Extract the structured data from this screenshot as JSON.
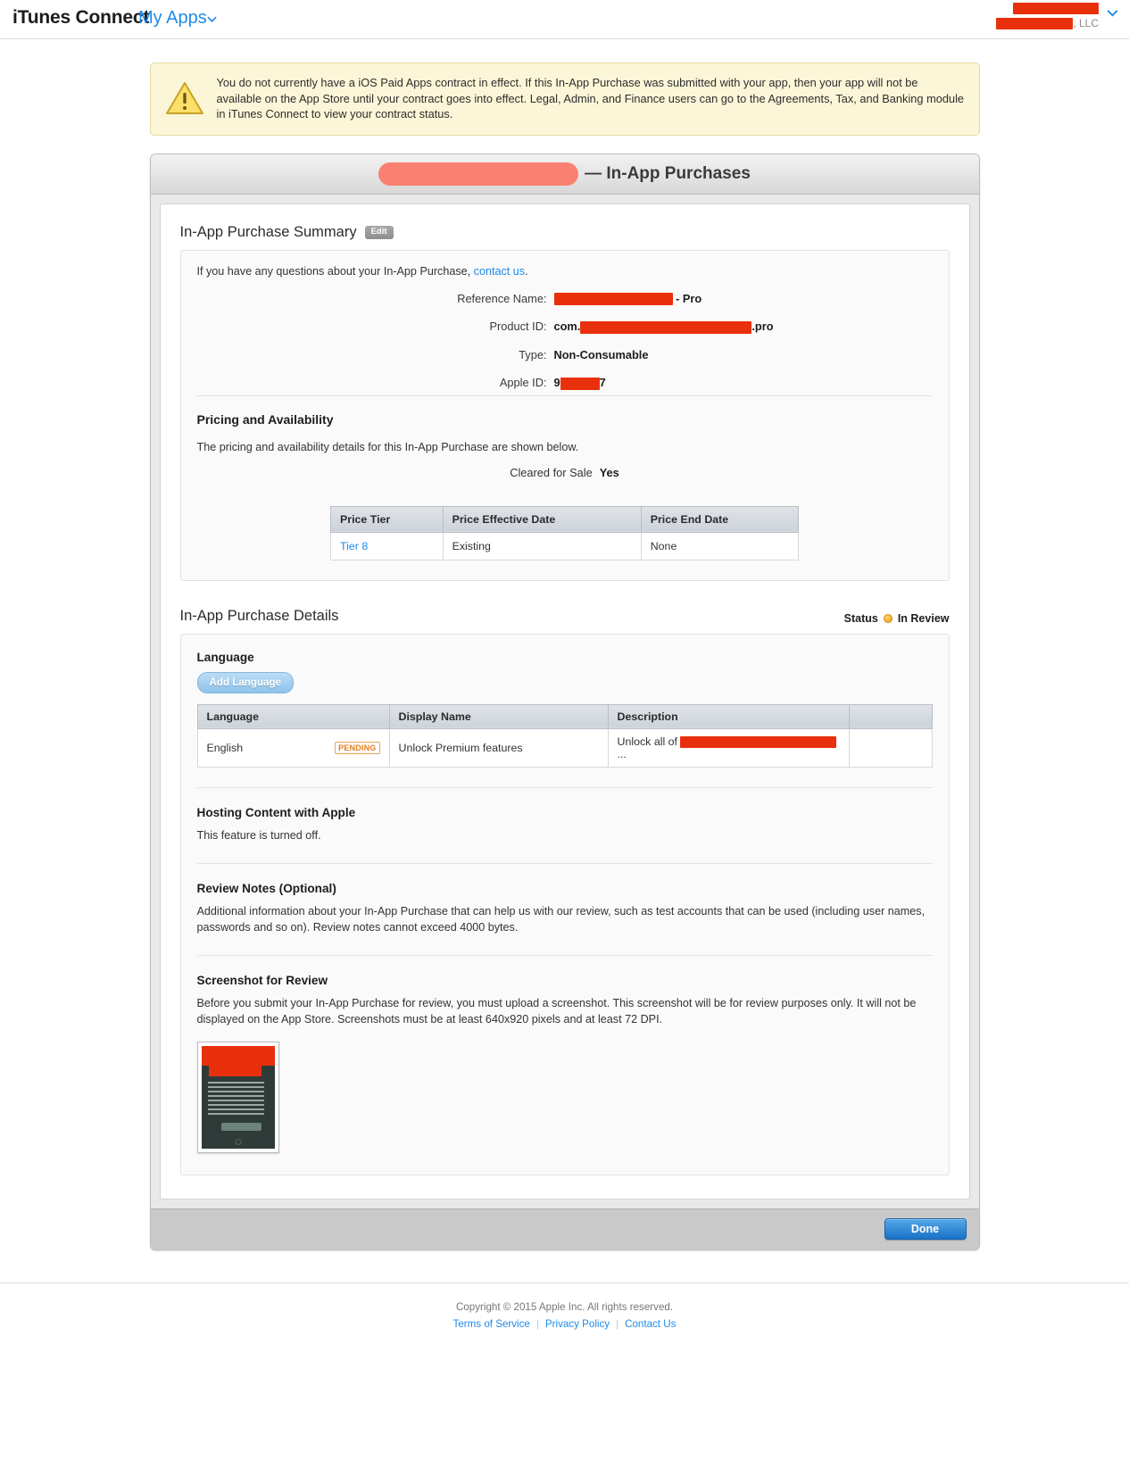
{
  "nav": {
    "brand": "iTunes Connect",
    "my_apps": "My Apps",
    "chevron_icon": "chevron-down-icon",
    "account_company_suffix": ", LLC",
    "account_chevron_icon": "chevron-down-icon"
  },
  "warning": {
    "icon": "warning-triangle-icon",
    "text": "You do not currently have a iOS Paid Apps contract in effect. If this In-App Purchase was submitted with your app, then your app will not be available on the App Store until your contract goes into effect. Legal, Admin, and Finance users can go to the Agreements, Tax, and Banking module in iTunes Connect to view your contract status."
  },
  "panel": {
    "title_suffix": "— In-App Purchases",
    "done_label": "Done"
  },
  "summary": {
    "heading": "In-App Purchase Summary",
    "edit_label": "Edit",
    "question_prefix": "If you have any questions about your In-App Purchase, ",
    "contact_link": "contact us",
    "question_suffix": ".",
    "fields": {
      "reference_name_label": "Reference Name:",
      "reference_name_suffix": "- Pro",
      "product_id_label": "Product ID:",
      "product_id_prefix": "com.",
      "product_id_suffix": ".pro",
      "type_label": "Type:",
      "type_value": "Non-Consumable",
      "apple_id_label": "Apple ID:",
      "apple_id_prefix": "9",
      "apple_id_suffix": "7"
    }
  },
  "pricing": {
    "heading": "Pricing and Availability",
    "note": "The pricing and availability details for this In-App Purchase are shown below.",
    "cleared_label": "Cleared for Sale",
    "cleared_value": "Yes",
    "table": {
      "columns": [
        "Price Tier",
        "Price Effective Date",
        "Price End Date"
      ],
      "rows": [
        {
          "tier": "Tier 8",
          "effective": "Existing",
          "end": "None"
        }
      ]
    }
  },
  "details": {
    "heading": "In-App Purchase Details",
    "status_label": "Status",
    "status_icon": "orange-status-dot-icon",
    "status_value": "In Review",
    "language": {
      "heading": "Language",
      "add_button": "Add Language",
      "columns": [
        "Language",
        "Display Name",
        "Description",
        ""
      ],
      "rows": [
        {
          "language": "English",
          "badge": "PENDING",
          "display_name": "Unlock Premium features",
          "description_prefix": "Unlock all of ",
          "description_suffix": "..."
        }
      ]
    },
    "hosting": {
      "heading": "Hosting Content with Apple",
      "text": "This feature is turned off."
    },
    "review_notes": {
      "heading": "Review Notes (Optional)",
      "text": "Additional information about your In-App Purchase that can help us with our review, such as test accounts that can be used (including user names, passwords and so on). Review notes cannot exceed 4000 bytes."
    },
    "screenshot": {
      "heading": "Screenshot for Review",
      "text": "Before you submit your In-App Purchase for review, you must upload a screenshot. This screenshot will be for review purposes only. It will not be displayed on the App Store. Screenshots must be at least 640x920 pixels and at least 72 DPI.",
      "thumb_name": "review-screenshot-thumbnail"
    }
  },
  "footer": {
    "copyright": "Copyright © 2015 Apple Inc. All rights reserved.",
    "links": [
      "Terms of Service",
      "Privacy Policy",
      "Contact Us"
    ],
    "separator": "|"
  },
  "colors": {
    "link": "#1e8ae8",
    "redaction": "#e8300c",
    "redaction_pink": "#fa8072",
    "status_orange": "#f0a010",
    "warning_bg": "#fcf6d8"
  }
}
